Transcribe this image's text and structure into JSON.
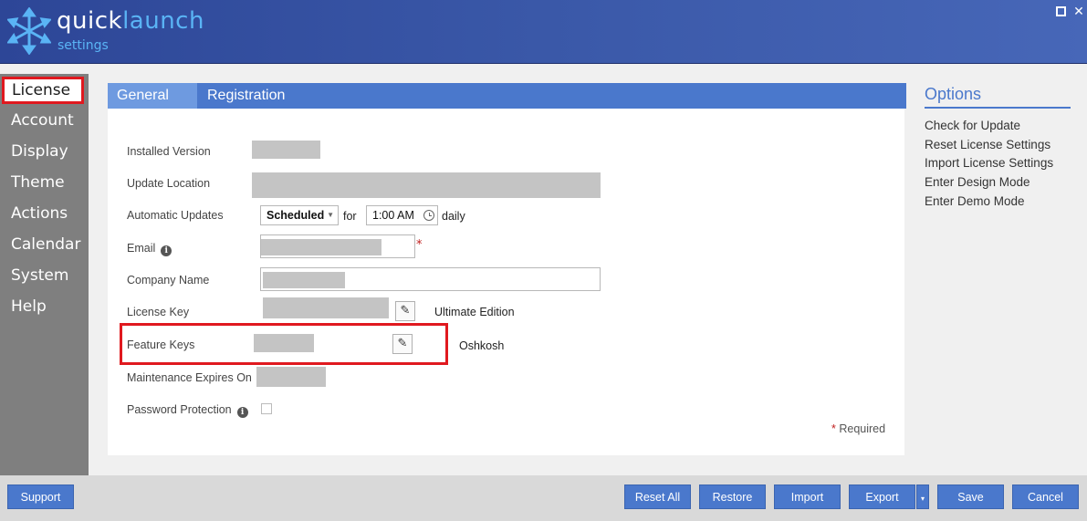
{
  "app": {
    "brand_quick": "quick",
    "brand_launch": "launch",
    "brand_sub": "settings",
    "close_glyph": "✕"
  },
  "sidebar": {
    "items": [
      {
        "label": "License",
        "active": true
      },
      {
        "label": "Account"
      },
      {
        "label": "Display"
      },
      {
        "label": "Theme"
      },
      {
        "label": "Actions"
      },
      {
        "label": "Calendar"
      },
      {
        "label": "System"
      },
      {
        "label": "Help"
      }
    ]
  },
  "tabs": [
    {
      "label": "General",
      "active": true
    },
    {
      "label": "Registration"
    }
  ],
  "form": {
    "installed_version_label": "Installed Version",
    "update_location_label": "Update Location",
    "automatic_updates_label": "Automatic Updates",
    "schedule_value": "Scheduled",
    "for_text": "for",
    "time_value": "1:00 AM",
    "daily_text": "daily",
    "email_label": "Email",
    "required_marker": "*",
    "company_name_label": "Company Name",
    "license_key_label": "License Key",
    "edition_text": "Ultimate Edition",
    "feature_keys_label": "Feature Keys",
    "feature_keys_note": "Oshkosh",
    "maintenance_label": "Maintenance Expires On",
    "password_label": "Password Protection",
    "required_note": "Required",
    "info_glyph": "i",
    "edit_glyph": "✎"
  },
  "options": {
    "title": "Options",
    "items": [
      "Check for Update",
      "Reset License Settings",
      "Import License Settings",
      "Enter Design Mode",
      "Enter Demo Mode"
    ]
  },
  "buttons": {
    "support": "Support",
    "reset_all": "Reset All",
    "restore": "Restore",
    "import": "Import",
    "export": "Export",
    "export_caret": "▾",
    "save": "Save",
    "cancel": "Cancel"
  },
  "colors": {
    "accent": "#4a78cc",
    "highlight": "#e0191f"
  }
}
